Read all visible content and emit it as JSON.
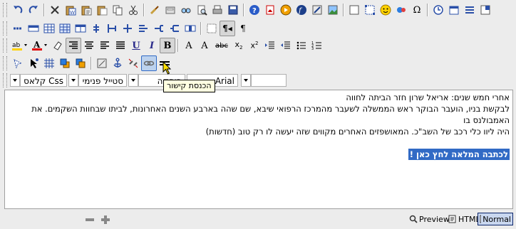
{
  "toolbar": {
    "row1": [
      "undo-icon",
      "redo-icon",
      "sep",
      "cut-icon",
      "paste-word-icon",
      "paste-text-icon",
      "paste-icon",
      "copy-icon",
      "cut-scissors-icon",
      "sep",
      "spellcheck-icon",
      "form-icon",
      "find-icon",
      "find-replace-icon",
      "print-icon",
      "save-icon",
      "sep",
      "help-icon",
      "pdf-icon",
      "flash-icon",
      "media-icon",
      "image-icon",
      "image-map-icon",
      "sep",
      "frame-icon",
      "fullscreen-icon",
      "smiley-icon",
      "gallery-icon",
      "omega-icon",
      "sep",
      "clock-icon",
      "date-icon",
      "template-icon",
      "font-size-icon"
    ],
    "row2": [
      "table-insert-icon",
      "table-row-icon",
      "table-col-icon",
      "table-icon",
      "table-props-icon",
      "merge-icon",
      "split-icon",
      "insert-col-icon",
      "delete-col-icon",
      "insert-row-icon",
      "delete-row-icon",
      "cell-props-icon",
      "sep",
      "grid-icon",
      "rtl-icon",
      "ltr-icon"
    ],
    "row3": [
      "highlight-icon",
      "font-color-icon",
      "eraser-icon",
      "align-right-icon",
      "align-center-icon",
      "align-left-icon",
      "justify-icon",
      "underline-icon",
      "italic-icon",
      "bold-icon",
      "sep",
      "superscript-a-icon",
      "subscript-a-icon",
      "strikethrough-icon",
      "subscript-icon",
      "superscript-icon",
      "indent-icon",
      "outdent-icon",
      "bullet-list-icon",
      "numbered-list-icon"
    ],
    "row4": [
      "select-icon",
      "cursor-icon",
      "table-grid-icon",
      "layer-icon",
      "layer-back-icon",
      "sep",
      "anchor-icon",
      "unlink-icon",
      "link-icon",
      "horizontal-rule-icon"
    ],
    "labels": {
      "underline": "U",
      "italic": "I",
      "bold": "B",
      "ab_super": "A",
      "ab_sub": "A",
      "strike": "abc",
      "sub": "x",
      "sup": "x",
      "omega": "Ω",
      "ltr": "¶"
    }
  },
  "combos": {
    "css_class": "Css קלאס",
    "inline_style": "סטייל פנימי",
    "font_size": "פיסקה",
    "font_name": "Arial"
  },
  "tooltip": "הכנסת קישור",
  "editor": {
    "line1": "אחרי חמש שנים: אריאל שרון חזר הביתה לחווה",
    "line2": "לבקשת בניו, הועבר הבוקר ראש הממשלה לשעבר מהמרכז הרפואי שיבא, שם שהה בארבע השנים האחרונות, לביתו שבחוות השקמים. את האמבולנס בו",
    "line3": "היה ליוו כלי רכב של השב\"כ. המאושפזים האחרים מקווים שזה יעשה לו רק טוב (חדשות)",
    "selected_link": "לכתבה המלאה לחץ כאן !"
  },
  "statusbar": {
    "preview": "Preview",
    "html": "HTML",
    "normal": "Normal"
  },
  "colors": {
    "selection": "#316ac5",
    "tooltip_bg": "#ffffe1",
    "toolbar_bg": "#ececec"
  }
}
